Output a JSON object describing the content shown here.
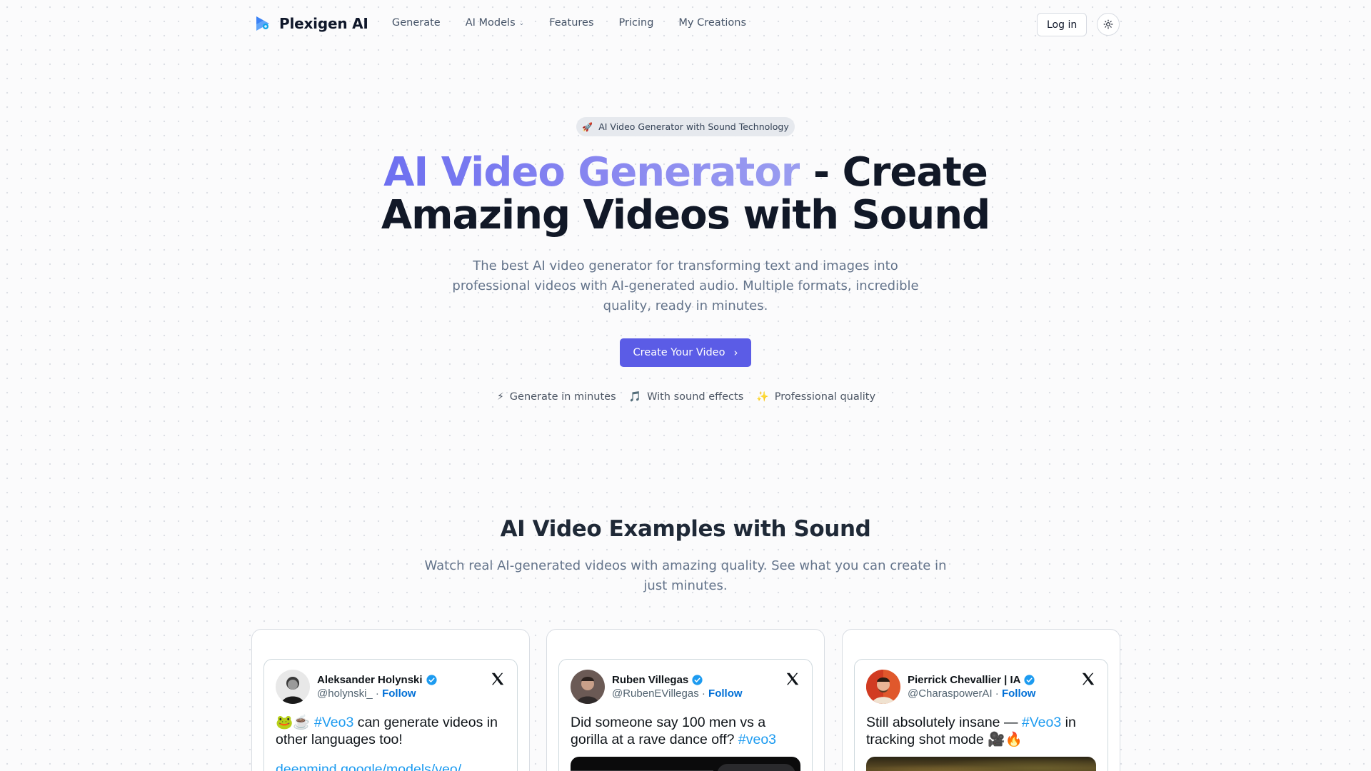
{
  "nav": {
    "brand": "Plexigen AI",
    "links": [
      {
        "label": "Generate"
      },
      {
        "label": "AI Models",
        "dropdown": true
      },
      {
        "label": "Features"
      },
      {
        "label": "Pricing"
      },
      {
        "label": "My Creations"
      }
    ],
    "login_label": "Log in"
  },
  "hero": {
    "badge_icon": "🚀",
    "badge": "AI Video Generator with Sound Technology",
    "title_highlight": "AI Video Generator",
    "title_rest_1": " - Create",
    "title_rest_2": "Amazing Videos with Sound",
    "subtitle": "The best AI video generator for transforming text and images into professional videos with AI-generated audio. Multiple formats, incredible quality, ready in minutes.",
    "cta_label": "Create Your Video",
    "features": [
      {
        "icon": "⚡",
        "label": "Generate in minutes"
      },
      {
        "icon": "🎵",
        "label": "With sound effects"
      },
      {
        "icon": "✨",
        "label": "Professional quality"
      }
    ]
  },
  "examples": {
    "title": "AI Video Examples with Sound",
    "subtitle": "Watch real AI-generated videos with amazing quality. See what you can create in just minutes.",
    "tweets": [
      {
        "name": "Aleksander Holynski",
        "handle": "@holynski_",
        "separator": " · ",
        "follow": "Follow",
        "text_prefix": "🐸☕ ",
        "tag": "#Veo3",
        "text_suffix": " can generate videos in other languages too!",
        "link": "deepmind.google/models/veo/"
      },
      {
        "name": "Ruben Villegas",
        "handle": "@RubenEVillegas",
        "separator": " · ",
        "follow": "Follow",
        "text_prefix": "Did someone say 100 men vs a gorilla at a rave dance off? ",
        "tag": "#veo3",
        "text_suffix": ""
      },
      {
        "name": "Pierrick Chevallier | IA",
        "handle": "@CharaspowerAI",
        "separator": " · ",
        "follow": "Follow",
        "text_prefix": "Still absolutely insane — ",
        "tag": "#Veo3",
        "text_suffix": " in tracking shot mode 🎥🔥"
      }
    ]
  },
  "colors": {
    "accent": "#5b5ce6",
    "link_blue": "#1d9bf0",
    "verified_blue": "#1d9bf0"
  }
}
